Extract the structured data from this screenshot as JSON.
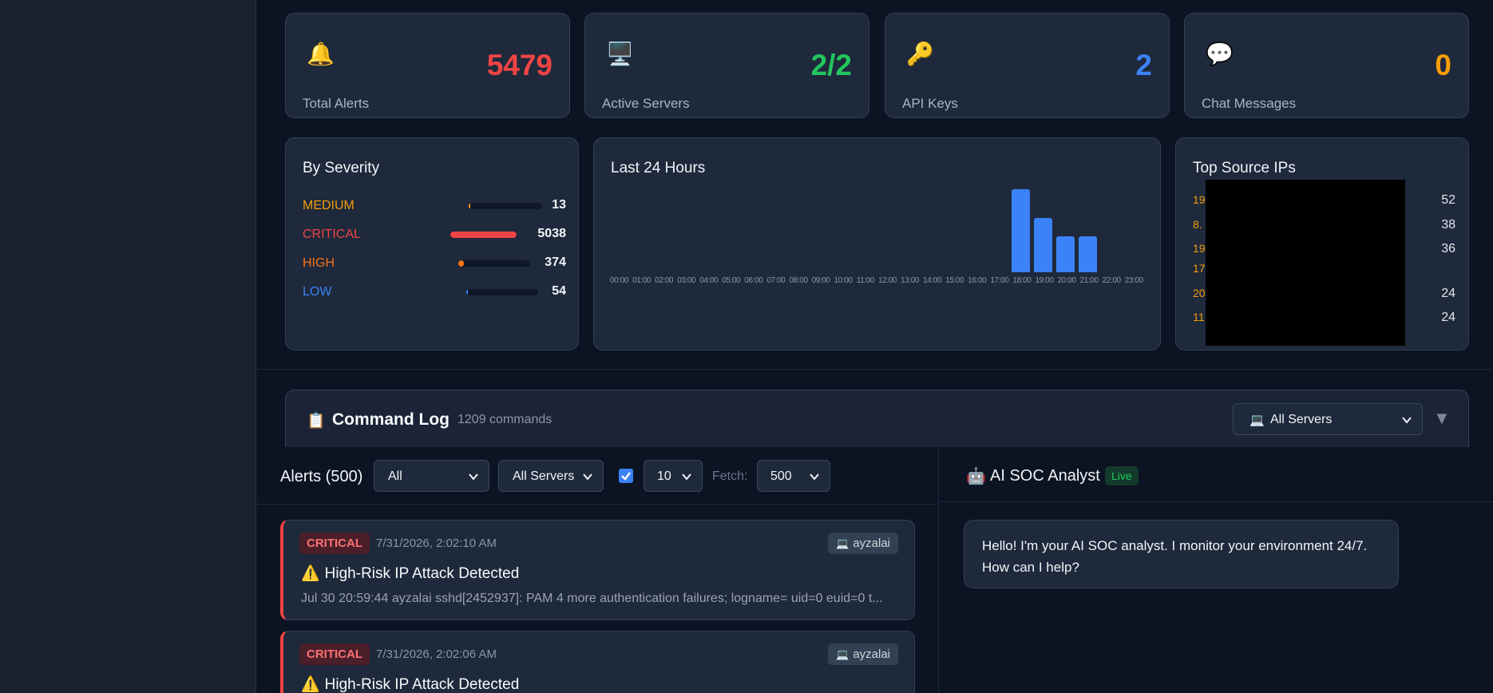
{
  "stats": [
    {
      "icon": "🔔",
      "value": "5479",
      "label": "Total Alerts",
      "color": "#ef4444"
    },
    {
      "icon": "🖥️",
      "value": "2/2",
      "label": "Active Servers",
      "color": "#22c55e"
    },
    {
      "icon": "🔑",
      "value": "2",
      "label": "API Keys",
      "color": "#3b82f6"
    },
    {
      "icon": "💬",
      "value": "0",
      "label": "Chat Messages",
      "color": "#f59e0b"
    }
  ],
  "severity": {
    "title": "By Severity",
    "rows": [
      {
        "name": "MEDIUM",
        "count": "13",
        "fraction": 0.003,
        "color": "#f59e0b"
      },
      {
        "name": "CRITICAL",
        "count": "5038",
        "fraction": 1.0,
        "color": "#ef4444"
      },
      {
        "name": "HIGH",
        "count": "374",
        "fraction": 0.074,
        "color": "#f97316"
      },
      {
        "name": "LOW",
        "count": "54",
        "fraction": 0.011,
        "color": "#3b82f6"
      }
    ]
  },
  "hourly": {
    "title": "Last 24 Hours",
    "hours": [
      "00:00",
      "01:00",
      "02:00",
      "03:00",
      "04:00",
      "05:00",
      "06:00",
      "07:00",
      "08:00",
      "09:00",
      "10:00",
      "11:00",
      "12:00",
      "13:00",
      "14:00",
      "15:00",
      "16:00",
      "17:00",
      "18:00",
      "19:00",
      "20:00",
      "21:00",
      "22:00",
      "23:00"
    ],
    "relative_counts": [
      0,
      0,
      0,
      0,
      0,
      0,
      0,
      0,
      0,
      0,
      0,
      0,
      0,
      0,
      0,
      0,
      0,
      0,
      1.0,
      0.65,
      0.43,
      0.43,
      0,
      0
    ]
  },
  "top_ips": {
    "title": "Top Source IPs",
    "rows": [
      {
        "ip": "19",
        "count": "52"
      },
      {
        "ip": "8.",
        "count": "38"
      },
      {
        "ip": "19",
        "count": "36"
      },
      {
        "ip": "17",
        "count": ""
      },
      {
        "ip": "20",
        "count": "24"
      },
      {
        "ip": "11",
        "count": "24"
      }
    ]
  },
  "command_log": {
    "icon": "📋",
    "title": "Command Log",
    "count": "1209 commands",
    "server_filter": "All Servers",
    "server_icon": "💻",
    "collapse_icon": "▼"
  },
  "alerts": {
    "header": "Alerts (500)",
    "severity_filter": "All",
    "server_filter": "All Servers",
    "limit": "10",
    "fetch_label": "Fetch:",
    "fetch_value": "500",
    "items": [
      {
        "severity": "CRITICAL",
        "time": "7/31/2026, 2:02:10 AM",
        "host": "ayzalai",
        "title": "High-Risk IP Attack Detected",
        "desc": "Jul 30 20:59:44 ayzalai sshd[2452937]: PAM 4 more authentication failures; logname= uid=0 euid=0 t..."
      },
      {
        "severity": "CRITICAL",
        "time": "7/31/2026, 2:02:06 AM",
        "host": "ayzalai",
        "title": "High-Risk IP Attack Detected",
        "desc": ""
      }
    ]
  },
  "ai": {
    "icon": "🤖",
    "title": "AI SOC Analyst",
    "status": "Live",
    "message": "Hello! I'm your AI SOC analyst. I monitor your environment 24/7. How can I help?"
  }
}
